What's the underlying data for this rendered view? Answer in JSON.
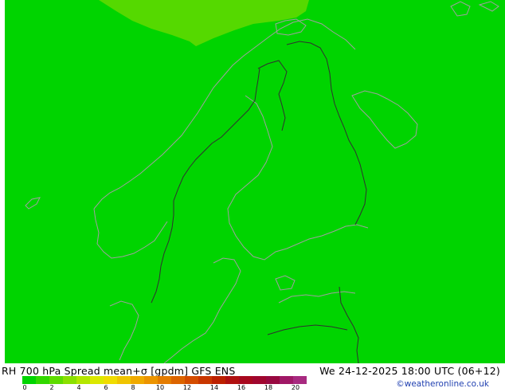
{
  "map": {
    "background_color": "#00d400",
    "high_value_area_color": "#55d900",
    "coastline_color": "#a0a0a0",
    "border_color": "#303030"
  },
  "footer": {
    "title_left": "RH 700 hPa Spread mean+σ [gpdm] GFS ENS",
    "title_right": "We 24-12-2025 18:00 UTC (06+12)",
    "credit": "©weatheronline.co.uk"
  },
  "legend": {
    "colors": [
      "#00d400",
      "#32d800",
      "#5fdc00",
      "#8be000",
      "#b4e600",
      "#dce800",
      "#f0dc00",
      "#f0c400",
      "#f0aa00",
      "#ec9400",
      "#e47c00",
      "#dc6400",
      "#d44c00",
      "#c83600",
      "#bc2000",
      "#b01010",
      "#a8081e",
      "#a0062e",
      "#980840",
      "#a01866",
      "#a82a80"
    ],
    "tick_labels": [
      "0",
      "2",
      "4",
      "6",
      "8",
      "10",
      "12",
      "14",
      "16",
      "18",
      "20"
    ]
  }
}
